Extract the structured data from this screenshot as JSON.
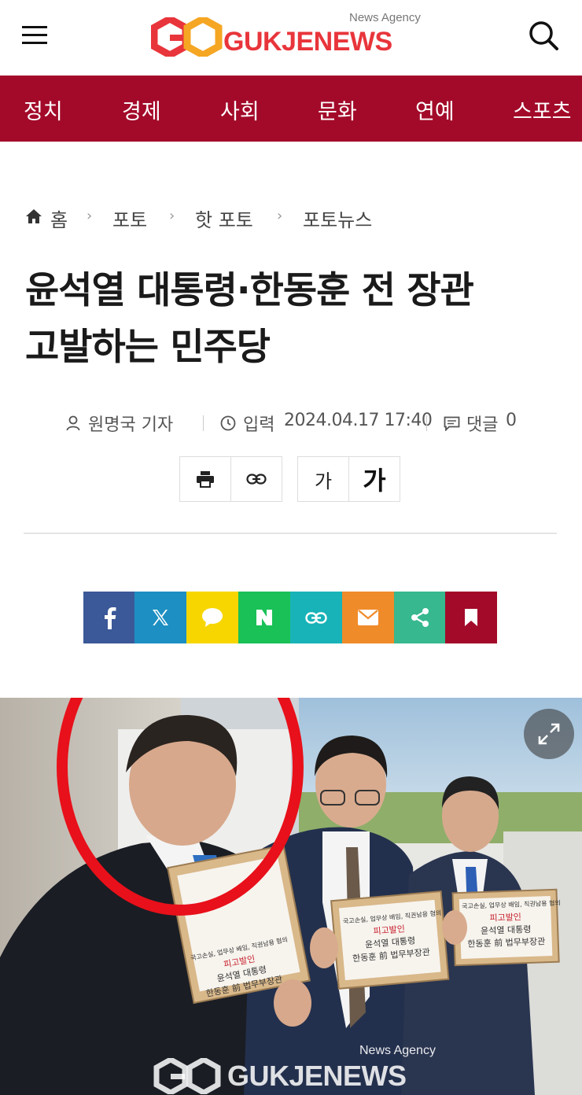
{
  "header": {
    "logo_text": "GUKJENEWS",
    "logo_tagline": "News Agency",
    "brand_color": "#e8353b"
  },
  "nav": {
    "background": "#a30a2a",
    "items": [
      "정치",
      "경제",
      "사회",
      "문화",
      "연예",
      "스포츠"
    ]
  },
  "breadcrumb": [
    "홈",
    "포토",
    "핫 포토",
    "포토뉴스"
  ],
  "article": {
    "title_line1": "윤석열 대통령·한동훈 전 장관",
    "title_line2": "고발하는 민주당",
    "author": "원명국 기자",
    "input_label": "입력",
    "date": "2024.04.17 17:40",
    "comments_label": "댓글",
    "comments_count": "0"
  },
  "tools": {
    "font_small": "가",
    "font_large": "가"
  },
  "share": [
    {
      "name": "facebook",
      "color": "#3b5998"
    },
    {
      "name": "x-twitter",
      "color": "#1d8fc2"
    },
    {
      "name": "kakaotalk",
      "color": "#f7d600"
    },
    {
      "name": "naver",
      "color": "#19c157"
    },
    {
      "name": "copy-link",
      "color": "#18b3b8"
    },
    {
      "name": "email",
      "color": "#f08b2a"
    },
    {
      "name": "share",
      "color": "#37b88e"
    },
    {
      "name": "bookmark",
      "color": "#a30a2a"
    }
  ],
  "photo": {
    "watermark_text": "GUKJENEWS",
    "watermark_tagline": "News Agency",
    "sign1": [
      "국고손실, 업무상 배임, 직권남용 혐의",
      "피고발인",
      "윤석열 대통령",
      "한동훈 前 법무부장관"
    ],
    "sign2": [
      "국고손실, 업무상 배임, 직권남용 혐의",
      "피고발인",
      "윤석열 대통령",
      "한동훈 前 법무부장관"
    ],
    "sign3": [
      "국고손실, 업무상 배임, 직권남용 혐의",
      "피고발인",
      "윤석열 대통령",
      "한동훈 前 법무부장관"
    ]
  }
}
